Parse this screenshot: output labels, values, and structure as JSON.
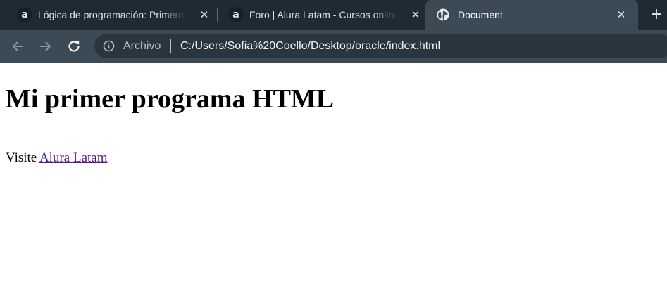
{
  "browser": {
    "tabs": [
      {
        "title": "Lógica de programación: Primeros",
        "favicon": "alura-a-icon"
      },
      {
        "title": "Foro | Alura Latam - Cursos online",
        "favicon": "alura-a-icon"
      },
      {
        "title": "Document",
        "favicon": "globe-icon",
        "active": true
      }
    ],
    "new_tab_glyph": "+",
    "close_glyph": "✕",
    "favicon_letter": "a",
    "omnibox": {
      "scheme_label": "Archivo",
      "url": "C:/Users/Sofia%20Coello/Desktop/oracle/index.html"
    }
  },
  "page": {
    "heading": "Mi primer programa HTML",
    "paragraph_prefix": "Visite",
    "link_text": "Alura Latam"
  },
  "colors": {
    "tab_strip": "#1f2a33",
    "toolbar": "#3b4a55",
    "link_visited": "#551a8b"
  }
}
